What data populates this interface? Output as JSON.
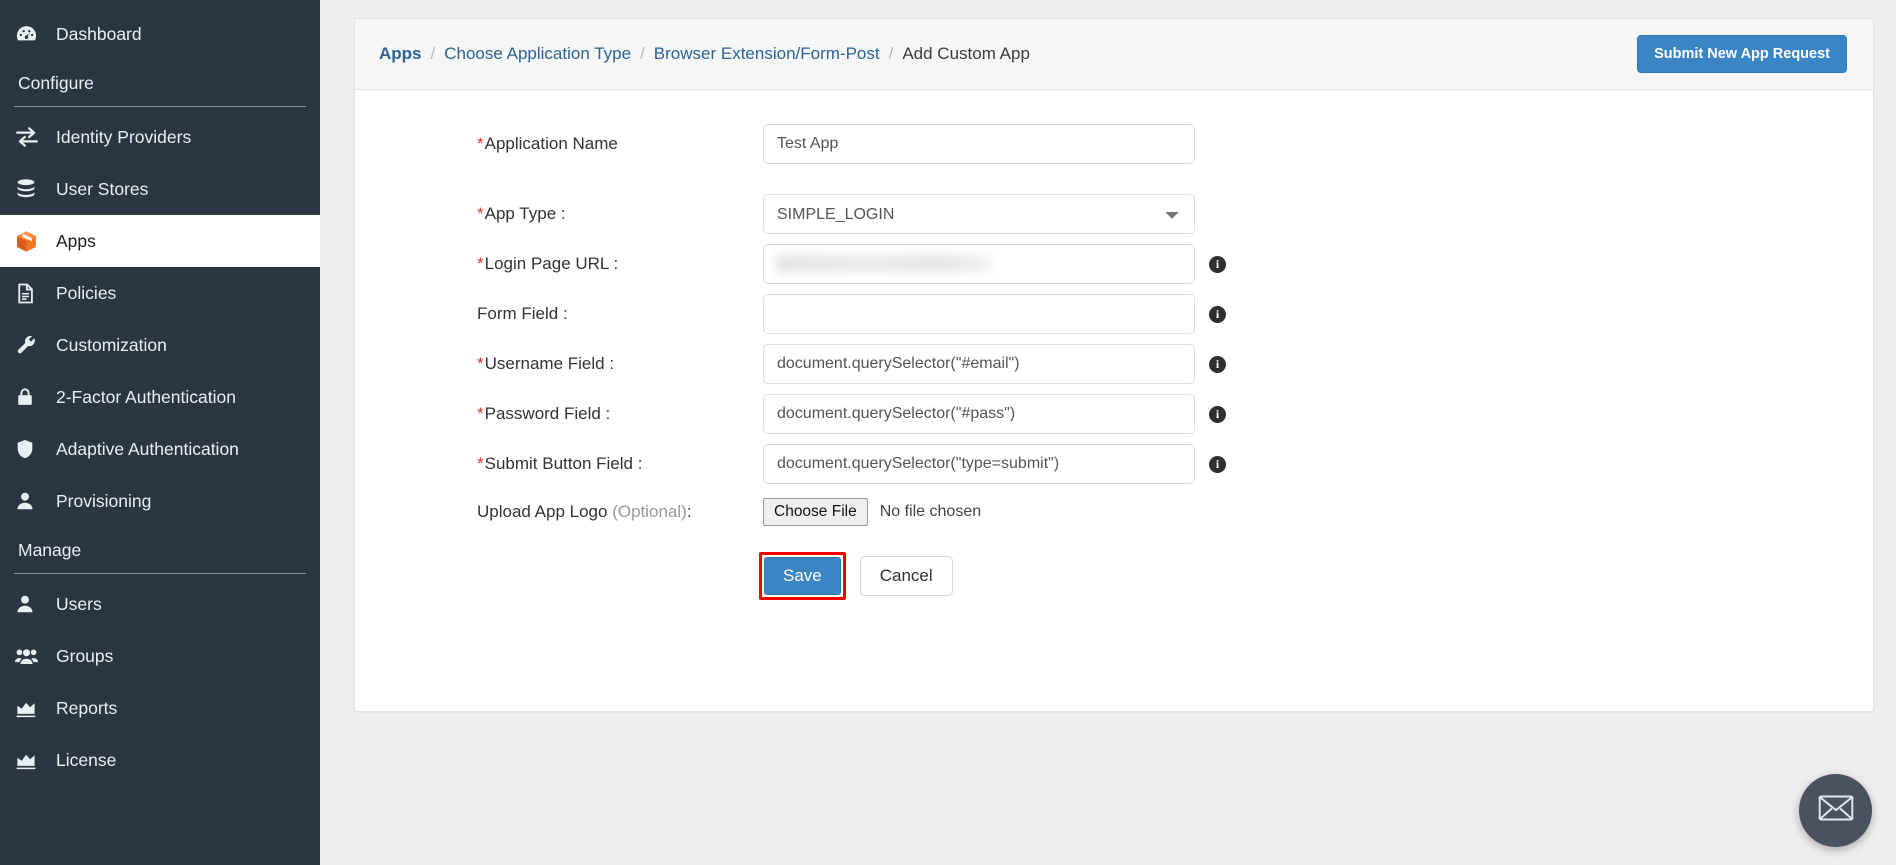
{
  "sidebar": {
    "top_items": [
      {
        "label": "Dashboard",
        "icon": "dashboard-gauge-icon",
        "active": false
      }
    ],
    "sections": [
      {
        "title": "Configure",
        "items": [
          {
            "label": "Identity Providers",
            "icon": "exchange-arrows-icon",
            "active": false
          },
          {
            "label": "User Stores",
            "icon": "database-stack-icon",
            "active": false
          },
          {
            "label": "Apps",
            "icon": "orange-cube-icon",
            "active": true
          },
          {
            "label": "Policies",
            "icon": "document-icon",
            "active": false
          },
          {
            "label": "Customization",
            "icon": "wrench-icon",
            "active": false
          },
          {
            "label": "2-Factor Authentication",
            "icon": "lock-icon",
            "active": false
          },
          {
            "label": "Adaptive Authentication",
            "icon": "shield-icon",
            "active": false
          },
          {
            "label": "Provisioning",
            "icon": "user-icon",
            "active": false
          }
        ]
      },
      {
        "title": "Manage",
        "items": [
          {
            "label": "Users",
            "icon": "user-icon",
            "active": false
          },
          {
            "label": "Groups",
            "icon": "users-group-icon",
            "active": false
          },
          {
            "label": "Reports",
            "icon": "chart-area-icon",
            "active": false
          },
          {
            "label": "License",
            "icon": "chart-area-icon",
            "active": false
          }
        ]
      }
    ]
  },
  "header": {
    "breadcrumb": [
      {
        "label": "Apps",
        "type": "link-bold"
      },
      {
        "label": "Choose Application Type",
        "type": "link"
      },
      {
        "label": "Browser Extension/Form-Post",
        "type": "link"
      },
      {
        "label": "Add Custom App",
        "type": "current"
      }
    ],
    "separator": "/",
    "submit_request_button": "Submit New App Request"
  },
  "form": {
    "fields": [
      {
        "label": "Application Name",
        "required": true,
        "control": "text",
        "value": "Test App",
        "placeholder": "",
        "info": false
      },
      {
        "label": "App Type :",
        "required": true,
        "control": "select",
        "value": "SIMPLE_LOGIN",
        "options": [
          "SIMPLE_LOGIN"
        ],
        "info": false
      },
      {
        "label": "Login Page URL :",
        "required": true,
        "control": "text-blurred",
        "value": "",
        "placeholder": "",
        "info": true
      },
      {
        "label": "Form Field :",
        "required": false,
        "control": "text",
        "value": "",
        "placeholder": "",
        "info": true
      },
      {
        "label": "Username Field :",
        "required": true,
        "control": "text",
        "value": "document.querySelector(\"#email\")",
        "placeholder": "",
        "info": true
      },
      {
        "label": "Password Field :",
        "required": true,
        "control": "text",
        "value": "document.querySelector(\"#pass\")",
        "placeholder": "",
        "info": true
      },
      {
        "label": "Submit Button Field :",
        "required": true,
        "control": "text",
        "value": "document.querySelector(\"type=submit\")",
        "placeholder": "",
        "info": true
      }
    ],
    "upload": {
      "label_main": "Upload App Logo",
      "label_optional": "(Optional)",
      "label_colon": ":",
      "choose_file_button": "Choose File",
      "file_status": "No file chosen"
    },
    "actions": {
      "save": "Save",
      "cancel": "Cancel",
      "save_highlight_color": "#f40000"
    },
    "required_marker": "*"
  },
  "fab": {
    "icon": "mail-envelope-icon"
  },
  "colors": {
    "sidebar_bg": "#2b3643",
    "sidebar_active_bg": "#ffffff",
    "accent_blue": "#3b85c4",
    "link_blue": "#2a6496",
    "required_red": "#d9332e",
    "apps_icon_orange": "#ee7624",
    "page_bg": "#ededed",
    "fab_bg": "#4a5260"
  }
}
